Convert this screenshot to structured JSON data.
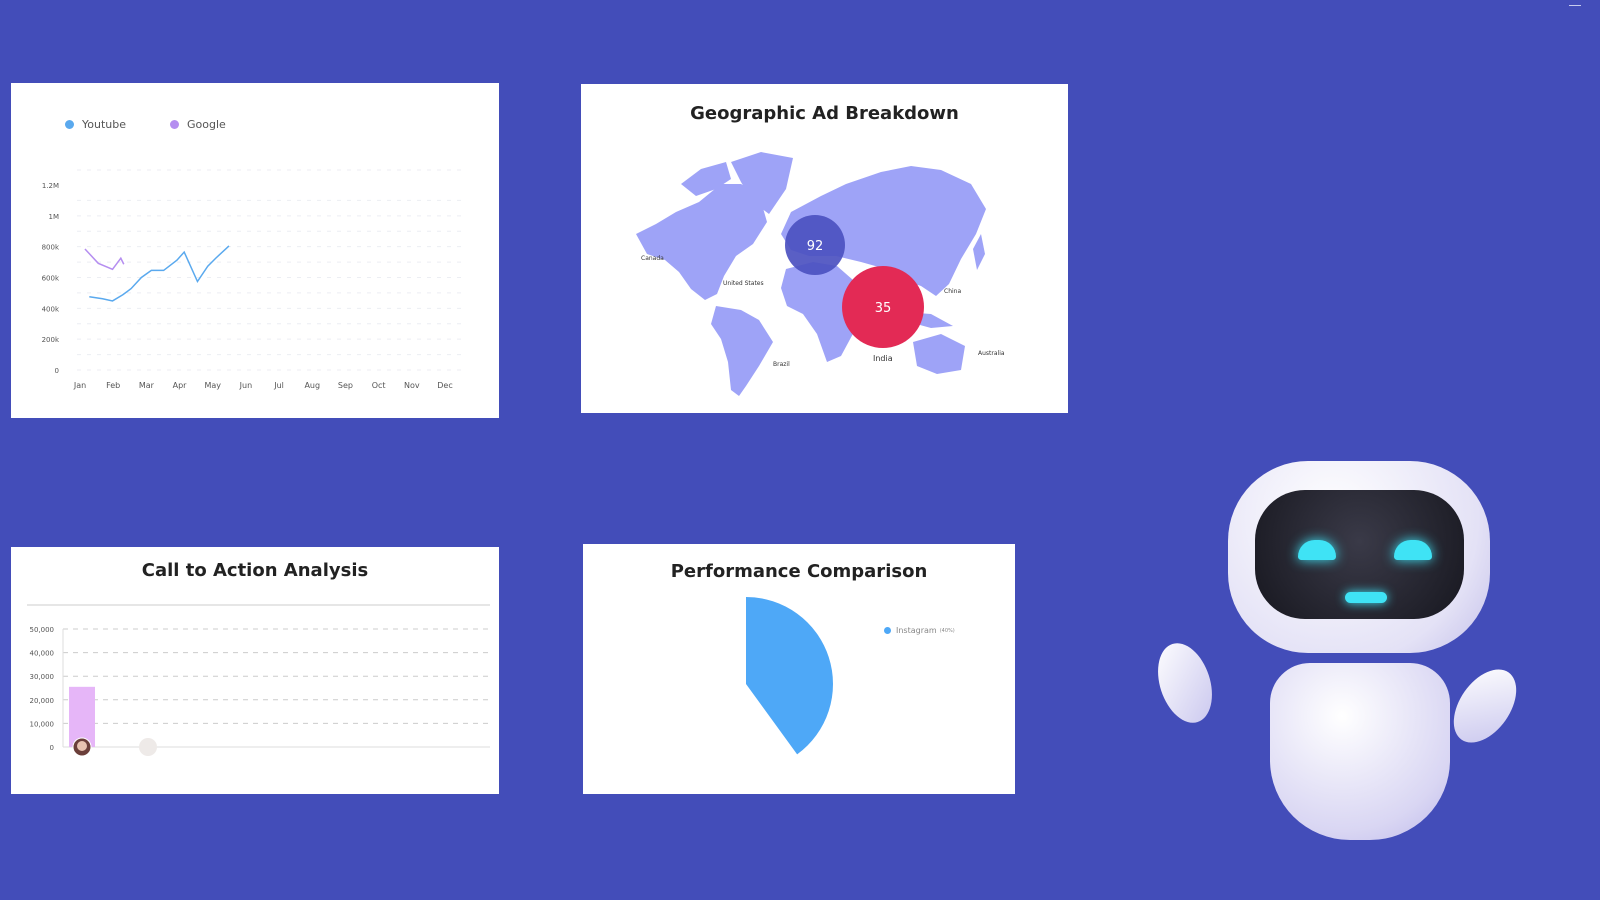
{
  "colors": {
    "background": "#434db9",
    "youtube": "#5aa9ee",
    "google": "#b58ef0",
    "bubble_europe": "#4c51c0",
    "bubble_india": "#e32a55",
    "map_land": "#9ea3f7",
    "bar": "#e6b6f8",
    "pie": "#4ea8f7"
  },
  "icons": {
    "window_control": "minimize-icon",
    "robot": "robot-mascot"
  },
  "line_chart": {
    "chart_data": {
      "type": "line",
      "legend_placement": "top-left",
      "grid": true,
      "categories": [
        "Jan",
        "Feb",
        "Mar",
        "Apr",
        "May",
        "Jun",
        "Jul",
        "Aug",
        "Sep",
        "Oct",
        "Nov",
        "Dec"
      ],
      "y_ticks": [
        "0",
        "200k",
        "400k",
        "600k",
        "800k",
        "1M",
        "1.2M"
      ],
      "ylim": [
        0,
        1200000
      ],
      "series": [
        {
          "name": "Youtube",
          "color": "#5aa9ee",
          "points": [
            [
              1.28,
              475000
            ],
            [
              1.68,
              462000
            ],
            [
              1.98,
              448000
            ],
            [
              2.29,
              488000
            ],
            [
              2.54,
              528000
            ],
            [
              2.85,
              600000
            ],
            [
              3.15,
              646000
            ],
            [
              3.52,
              646000
            ],
            [
              3.92,
              712000
            ],
            [
              4.14,
              765000
            ],
            [
              4.54,
              574000
            ],
            [
              4.85,
              673000
            ],
            [
              5.09,
              725000
            ],
            [
              5.49,
              805000
            ]
          ]
        },
        {
          "name": "Google",
          "color": "#b58ef0",
          "points": [
            [
              1.15,
              785000
            ],
            [
              1.55,
              692000
            ],
            [
              1.98,
              653000
            ],
            [
              2.23,
              725000
            ],
            [
              2.32,
              686000
            ]
          ]
        }
      ]
    }
  },
  "map_chart": {
    "title": "Geographic Ad Breakdown",
    "bubbles": [
      {
        "value": "92",
        "color": "#4c51c0"
      },
      {
        "value": "35",
        "color": "#e32a55"
      }
    ],
    "labels": {
      "canada": "Canada",
      "united_states": "United States",
      "china": "China",
      "india": "India",
      "brazil": "Brazil",
      "australia": "Australia"
    }
  },
  "bar_chart": {
    "title": "Call to Action Analysis",
    "chart_data": {
      "type": "bar",
      "y_ticks": [
        "0",
        "10,000",
        "20,000",
        "30,000",
        "40,000",
        "50,000"
      ],
      "ylim": [
        0,
        50000
      ],
      "grid": true,
      "values": [
        25500
      ]
    }
  },
  "pie_chart": {
    "title": "Performance Comparison",
    "chart_data": {
      "type": "pie",
      "slices": [
        {
          "name": "Instagram",
          "percent_label": "(40%)",
          "value": 40,
          "color": "#4ea8f7"
        }
      ]
    }
  }
}
